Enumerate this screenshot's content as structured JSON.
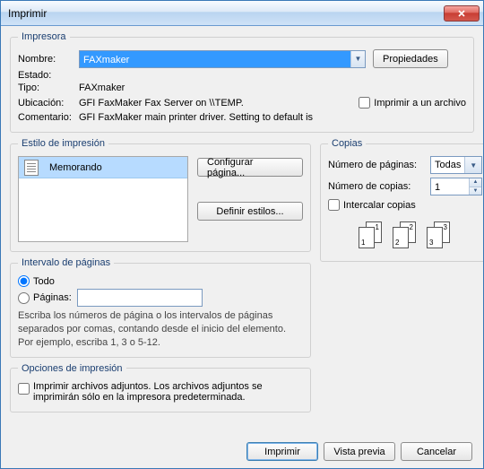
{
  "window": {
    "title": "Imprimir"
  },
  "printer": {
    "legend": "Impresora",
    "name_label": "Nombre:",
    "name_value": "FAXmaker",
    "properties_btn": "Propiedades",
    "state_label": "Estado:",
    "state_value": "",
    "type_label": "Tipo:",
    "type_value": "FAXmaker",
    "location_label": "Ubicación:",
    "location_value": "GFI FaxMaker Fax Server on \\\\TEMP.",
    "comment_label": "Comentario:",
    "comment_value": "GFI FaxMaker main printer driver. Setting to default is",
    "print_to_file": "Imprimir a un archivo"
  },
  "style": {
    "legend": "Estilo de impresión",
    "items": [
      "Memorando"
    ],
    "config_btn": "Configurar página...",
    "define_btn": "Definir estilos..."
  },
  "copies": {
    "legend": "Copias",
    "pages_label": "Número de páginas:",
    "pages_value": "Todas",
    "copies_label": "Número de copias:",
    "copies_value": "1",
    "collate_label": "Intercalar copias"
  },
  "range": {
    "legend": "Intervalo de páginas",
    "all_label": "Todo",
    "pages_label": "Páginas:",
    "hint": "Escriba los números de página o los intervalos de páginas separados por comas, contando desde el inicio del elemento. Por ejemplo, escriba 1, 3 o 5-12."
  },
  "options": {
    "legend": "Opciones de impresión",
    "attach_label": "Imprimir archivos adjuntos. Los archivos adjuntos se imprimirán sólo en la impresora predeterminada."
  },
  "buttons": {
    "print": "Imprimir",
    "preview": "Vista previa",
    "cancel": "Cancelar"
  }
}
